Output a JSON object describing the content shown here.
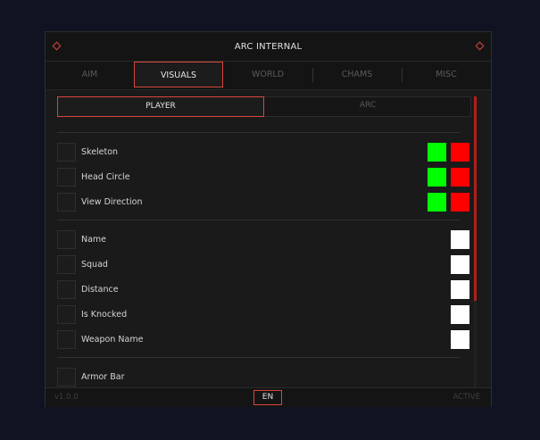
{
  "window": {
    "title": "ARC INTERNAL"
  },
  "tabs": [
    {
      "label": "AIM",
      "active": false
    },
    {
      "label": "VISUALS",
      "active": true
    },
    {
      "label": "WORLD",
      "active": false
    },
    {
      "label": "CHAMS",
      "active": false
    },
    {
      "label": "MISC",
      "active": false
    }
  ],
  "subtabs": [
    {
      "label": "PLAYER",
      "active": true
    },
    {
      "label": "ARC",
      "active": false
    }
  ],
  "colors": {
    "accent": "#d9463e",
    "green": "#00ff00",
    "red": "#ff0000",
    "white": "#ffffff",
    "scrollbar": "#b21e1a"
  },
  "groups": [
    {
      "items": [
        {
          "label": "Skeleton",
          "swatches": [
            "green",
            "red"
          ]
        },
        {
          "label": "Head Circle",
          "swatches": [
            "green",
            "red"
          ]
        },
        {
          "label": "View Direction",
          "swatches": [
            "green",
            "red"
          ]
        }
      ]
    },
    {
      "items": [
        {
          "label": "Name",
          "swatches": [
            "white"
          ]
        },
        {
          "label": "Squad",
          "swatches": [
            "white"
          ]
        },
        {
          "label": "Distance",
          "swatches": [
            "white"
          ]
        },
        {
          "label": "Is Knocked",
          "swatches": [
            "white"
          ]
        },
        {
          "label": "Weapon Name",
          "swatches": [
            "white"
          ]
        }
      ]
    },
    {
      "items": [
        {
          "label": "Armor Bar",
          "swatches": []
        }
      ]
    }
  ],
  "footer": {
    "version": "v1.0.0",
    "language": "EN",
    "status": "ACTIVE"
  }
}
